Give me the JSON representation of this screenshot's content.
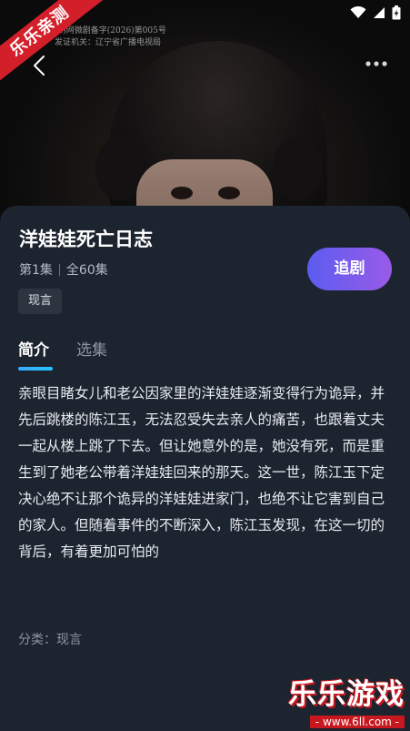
{
  "hero": {
    "overlay_lines": [
      "(2)网微剧备字(2026)第005号",
      "发证机关：辽宁省广播电视局"
    ]
  },
  "watermark_ribbon": "乐乐亲测",
  "drama": {
    "title": "洋娃娃死亡日志",
    "current_episode": "第1集",
    "total_episodes": "全60集",
    "genre_tag": "现言",
    "follow_label": "追剧"
  },
  "tabs": [
    {
      "label": "简介",
      "active": true
    },
    {
      "label": "选集",
      "active": false
    }
  ],
  "synopsis": "亲眼目睹女儿和老公因家里的洋娃娃逐渐变得行为诡异，并先后跳楼的陈江玉，无法忍受失去亲人的痛苦，也跟着丈夫一起从楼上跳了下去。但让她意外的是，她没有死，而是重生到了她老公带着洋娃娃回来的那天。这一世，陈江玉下定决心绝不让那个诡异的洋娃娃进家门，也绝不让它害到自己的家人。但随着事件的不断深入，陈江玉发现，在这一切的背后，有着更加可怕的",
  "category": "分类：现言",
  "watermark": {
    "title": "乐乐游戏",
    "url": "- www.6ll.com -"
  },
  "colors": {
    "accent_gradient_start": "#5b5cf0",
    "accent_gradient_end": "#9a5be8",
    "tab_indicator": "#3aa8ff",
    "panel_bg": "#1c2430",
    "ribbon_red": "#d21f2a"
  }
}
